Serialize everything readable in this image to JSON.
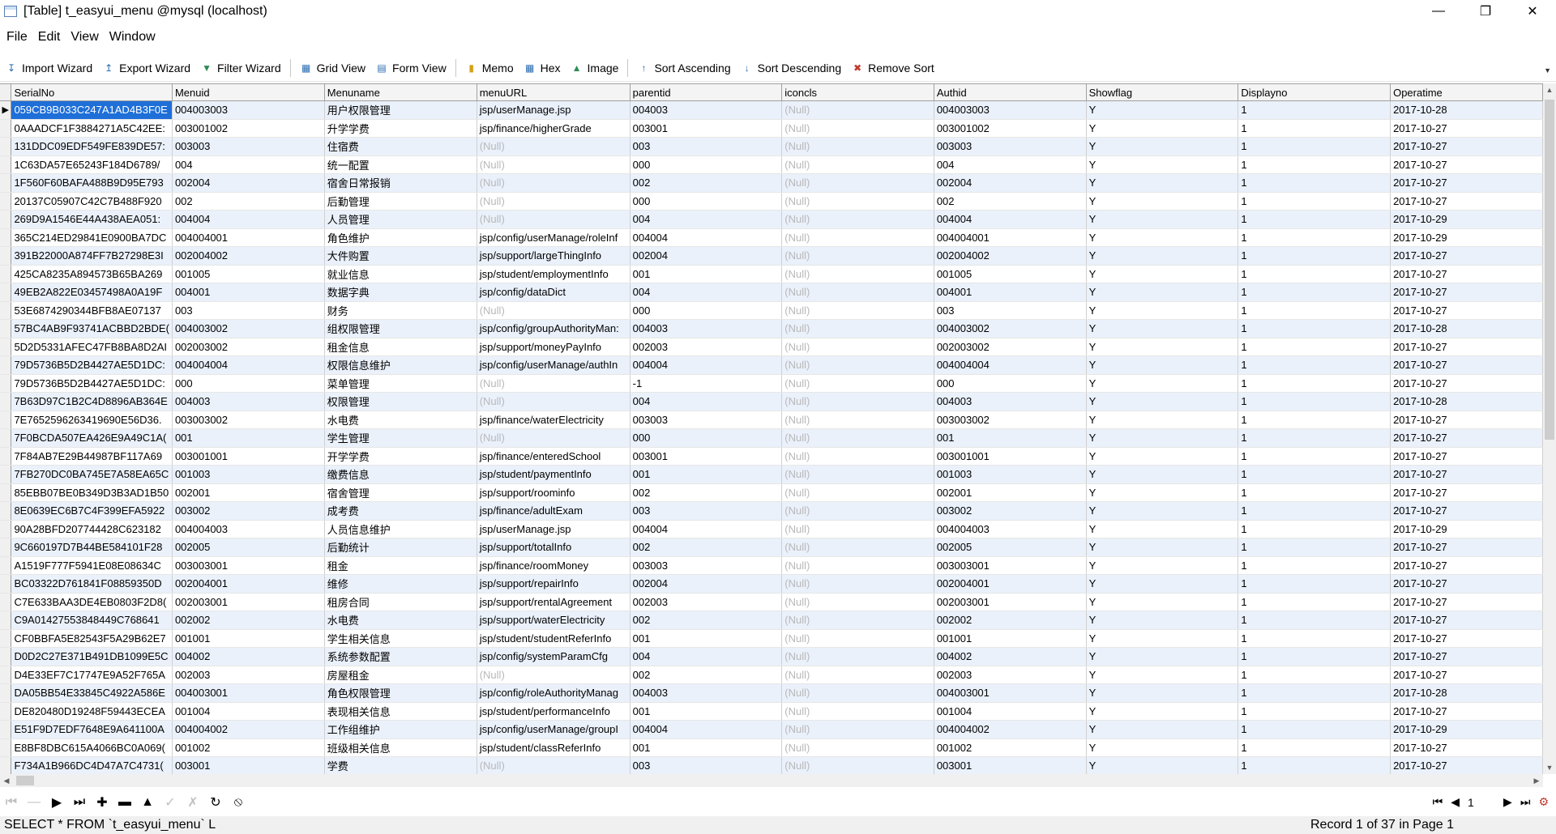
{
  "window": {
    "title": "[Table] t_easyui_menu @mysql (localhost)"
  },
  "menubar": [
    "File",
    "Edit",
    "View",
    "Window"
  ],
  "toolbar": {
    "import_wizard": "Import Wizard",
    "export_wizard": "Export Wizard",
    "filter_wizard": "Filter Wizard",
    "grid_view": "Grid View",
    "form_view": "Form View",
    "memo": "Memo",
    "hex": "Hex",
    "image": "Image",
    "sort_ascending": "Sort Ascending",
    "sort_descending": "Sort Descending",
    "remove_sort": "Remove Sort"
  },
  "table": {
    "columns": [
      "SerialNo",
      "Menuid",
      "Menuname",
      "menuURL",
      "parentid",
      "iconcls",
      "Authid",
      "Showflag",
      "Displayno",
      "Operatime"
    ],
    "rows": [
      [
        "059CB9B033C247A1AD4B3F0E",
        "004003003",
        "用户权限管理",
        "jsp/userManage.jsp",
        "004003",
        "(Null)",
        "004003003",
        "Y",
        "1",
        "2017-10-28"
      ],
      [
        "0AAADCF1F3884271A5C42EE:",
        "003001002",
        "升学学费",
        "jsp/finance/higherGrade",
        "003001",
        "(Null)",
        "003001002",
        "Y",
        "1",
        "2017-10-27"
      ],
      [
        "131DDC09EDF549FE839DE57:",
        "003003",
        "住宿费",
        "(Null)",
        "003",
        "(Null)",
        "003003",
        "Y",
        "1",
        "2017-10-27"
      ],
      [
        "1C63DA57E65243F184D6789/",
        "004",
        "统一配置",
        "(Null)",
        "000",
        "(Null)",
        "004",
        "Y",
        "1",
        "2017-10-27"
      ],
      [
        "1F560F60BAFA488B9D95E793",
        "002004",
        "宿舍日常报销",
        "(Null)",
        "002",
        "(Null)",
        "002004",
        "Y",
        "1",
        "2017-10-27"
      ],
      [
        "20137C05907C42C7B488F920",
        "002",
        "后勤管理",
        "(Null)",
        "000",
        "(Null)",
        "002",
        "Y",
        "1",
        "2017-10-27"
      ],
      [
        "269D9A1546E44A438AEA051:",
        "004004",
        "人员管理",
        "(Null)",
        "004",
        "(Null)",
        "004004",
        "Y",
        "1",
        "2017-10-29"
      ],
      [
        "365C214ED29841E0900BA7DC",
        "004004001",
        "角色维护",
        "jsp/config/userManage/roleInf",
        "004004",
        "(Null)",
        "004004001",
        "Y",
        "1",
        "2017-10-29"
      ],
      [
        "391B22000A874FF7B27298E3I",
        "002004002",
        "大件购置",
        "jsp/support/largeThingInfo",
        "002004",
        "(Null)",
        "002004002",
        "Y",
        "1",
        "2017-10-27"
      ],
      [
        "425CA8235A894573B65BA269",
        "001005",
        "就业信息",
        "jsp/student/employmentInfo",
        "001",
        "(Null)",
        "001005",
        "Y",
        "1",
        "2017-10-27"
      ],
      [
        "49EB2A822E03457498A0A19F",
        "004001",
        "数据字典",
        "jsp/config/dataDict",
        "004",
        "(Null)",
        "004001",
        "Y",
        "1",
        "2017-10-27"
      ],
      [
        "53E6874290344BFB8AE07137",
        "003",
        "财务",
        "(Null)",
        "000",
        "(Null)",
        "003",
        "Y",
        "1",
        "2017-10-27"
      ],
      [
        "57BC4AB9F93741ACBBD2BDE(",
        "004003002",
        "组权限管理",
        "jsp/config/groupAuthorityMan:",
        "004003",
        "(Null)",
        "004003002",
        "Y",
        "1",
        "2017-10-28"
      ],
      [
        "5D2D5331AFEC47FB8BA8D2AI",
        "002003002",
        "租金信息",
        "jsp/support/moneyPayInfo",
        "002003",
        "(Null)",
        "002003002",
        "Y",
        "1",
        "2017-10-27"
      ],
      [
        "79D5736B5D2B4427AE5D1DC:",
        "004004004",
        "权限信息维护",
        "jsp/config/userManage/authIn",
        "004004",
        "(Null)",
        "004004004",
        "Y",
        "1",
        "2017-10-27"
      ],
      [
        "79D5736B5D2B4427AE5D1DC:",
        "000",
        "菜单管理",
        "(Null)",
        "-1",
        "(Null)",
        "000",
        "Y",
        "1",
        "2017-10-27"
      ],
      [
        "7B63D97C1B2C4D8896AB364E",
        "004003",
        "权限管理",
        "(Null)",
        "004",
        "(Null)",
        "004003",
        "Y",
        "1",
        "2017-10-28"
      ],
      [
        "7E7652596263419690E56D36.",
        "003003002",
        "水电费",
        "jsp/finance/waterElectricity",
        "003003",
        "(Null)",
        "003003002",
        "Y",
        "1",
        "2017-10-27"
      ],
      [
        "7F0BCDA507EA426E9A49C1A(",
        "001",
        "学生管理",
        "(Null)",
        "000",
        "(Null)",
        "001",
        "Y",
        "1",
        "2017-10-27"
      ],
      [
        "7F84AB7E29B44987BF117A69",
        "003001001",
        "开学学费",
        "jsp/finance/enteredSchool",
        "003001",
        "(Null)",
        "003001001",
        "Y",
        "1",
        "2017-10-27"
      ],
      [
        "7FB270DC0BA745E7A58EA65C",
        "001003",
        "缴费信息",
        "jsp/student/paymentInfo",
        "001",
        "(Null)",
        "001003",
        "Y",
        "1",
        "2017-10-27"
      ],
      [
        "85EBB07BE0B349D3B3AD1B50",
        "002001",
        "宿舍管理",
        "jsp/support/roominfo",
        "002",
        "(Null)",
        "002001",
        "Y",
        "1",
        "2017-10-27"
      ],
      [
        "8E0639EC6B7C4F399EFA5922",
        "003002",
        "成考费",
        "jsp/finance/adultExam",
        "003",
        "(Null)",
        "003002",
        "Y",
        "1",
        "2017-10-27"
      ],
      [
        "90A28BFD207744428C623182",
        "004004003",
        "人员信息维护",
        "jsp/userManage.jsp",
        "004004",
        "(Null)",
        "004004003",
        "Y",
        "1",
        "2017-10-29"
      ],
      [
        "9C660197D7B44BE584101F28",
        "002005",
        "后勤统计",
        "jsp/support/totalInfo",
        "002",
        "(Null)",
        "002005",
        "Y",
        "1",
        "2017-10-27"
      ],
      [
        "A1519F777F5941E08E08634C",
        "003003001",
        "租金",
        "jsp/finance/roomMoney",
        "003003",
        "(Null)",
        "003003001",
        "Y",
        "1",
        "2017-10-27"
      ],
      [
        "BC03322D761841F08859350D",
        "002004001",
        "维修",
        "jsp/support/repairInfo",
        "002004",
        "(Null)",
        "002004001",
        "Y",
        "1",
        "2017-10-27"
      ],
      [
        "C7E633BAA3DE4EB0803F2D8(",
        "002003001",
        "租房合同",
        "jsp/support/rentalAgreement",
        "002003",
        "(Null)",
        "002003001",
        "Y",
        "1",
        "2017-10-27"
      ],
      [
        "C9A01427553848449C768641",
        "002002",
        "水电费",
        "jsp/support/waterElectricity",
        "002",
        "(Null)",
        "002002",
        "Y",
        "1",
        "2017-10-27"
      ],
      [
        "CF0BBFA5E82543F5A29B62E7",
        "001001",
        "学生相关信息",
        "jsp/student/studentReferInfo",
        "001",
        "(Null)",
        "001001",
        "Y",
        "1",
        "2017-10-27"
      ],
      [
        "D0D2C27E371B491DB1099E5C",
        "004002",
        "系统参数配置",
        "jsp/config/systemParamCfg",
        "004",
        "(Null)",
        "004002",
        "Y",
        "1",
        "2017-10-27"
      ],
      [
        "D4E33EF7C17747E9A52F765A",
        "002003",
        "房屋租金",
        "(Null)",
        "002",
        "(Null)",
        "002003",
        "Y",
        "1",
        "2017-10-27"
      ],
      [
        "DA05BB54E33845C4922A586E",
        "004003001",
        "角色权限管理",
        "jsp/config/roleAuthorityManag",
        "004003",
        "(Null)",
        "004003001",
        "Y",
        "1",
        "2017-10-28"
      ],
      [
        "DE820480D19248F59443ECEA",
        "001004",
        "表现相关信息",
        "jsp/student/performanceInfo",
        "001",
        "(Null)",
        "001004",
        "Y",
        "1",
        "2017-10-27"
      ],
      [
        "E51F9D7EDF7648E9A641100A",
        "004004002",
        "工作组维护",
        "jsp/config/userManage/groupI",
        "004004",
        "(Null)",
        "004004002",
        "Y",
        "1",
        "2017-10-29"
      ],
      [
        "E8BF8DBC615A4066BC0A069(",
        "001002",
        "班级相关信息",
        "jsp/student/classReferInfo",
        "001",
        "(Null)",
        "001002",
        "Y",
        "1",
        "2017-10-27"
      ],
      [
        "F734A1B966DC4D47A7C4731(",
        "003001",
        "学费",
        "(Null)",
        "003",
        "(Null)",
        "003001",
        "Y",
        "1",
        "2017-10-27"
      ]
    ]
  },
  "pager": {
    "page": "1"
  },
  "status": {
    "sql": "SELECT * FROM `t_easyui_menu` L",
    "record": "Record 1 of 37 in Page 1"
  }
}
